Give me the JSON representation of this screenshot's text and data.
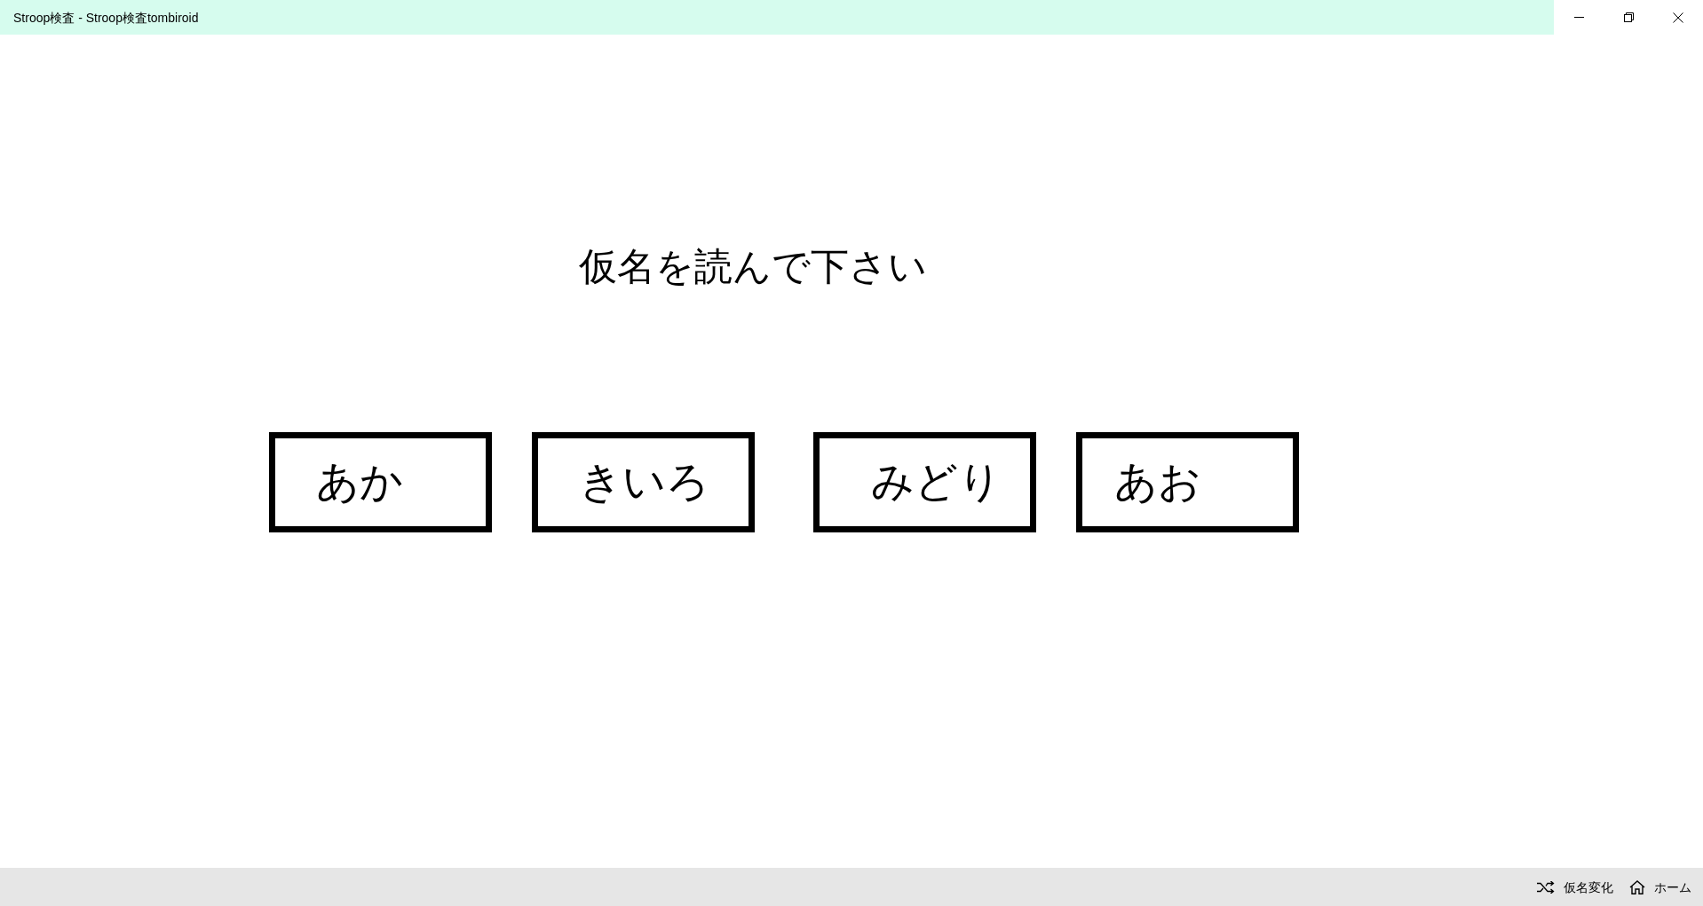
{
  "window": {
    "title": "Stroop検査 - Stroop検査tombiroid"
  },
  "prompt": "仮名を読んで下さい",
  "answers": [
    {
      "label": "あか"
    },
    {
      "label": "きいろ"
    },
    {
      "label": "みどり"
    },
    {
      "label": "あお"
    }
  ],
  "command_bar": {
    "items": [
      {
        "label": "仮名変化"
      },
      {
        "label": "ホーム"
      }
    ]
  }
}
